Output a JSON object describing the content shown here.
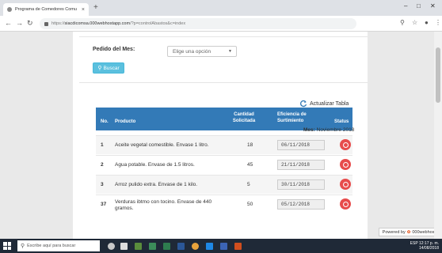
{
  "browser": {
    "tab_title": "Programa de Comedores Comu",
    "tab_close": "×",
    "new_tab": "+",
    "url_prefix": "https://",
    "url_domain": "siacdicomsa.000webhostapp.com",
    "url_path": "/?p=controlAbastos&c=index"
  },
  "form": {
    "pedido_label": "Pedido del Mes:",
    "select_value": "Elige una opción",
    "search_button": "Buscar"
  },
  "table": {
    "refresh_button": "Actualizar Tabla",
    "headers": {
      "no": "No.",
      "producto": "Producto",
      "cantidad": "Cantidad Solicitada",
      "eficiencia": "Eficiencia de Surtimiento",
      "status": "Status"
    },
    "mes_label": "Mes:",
    "mes_value": "Noviembre 2018",
    "rows": [
      {
        "no": "1",
        "producto": "Aceite vegetal comestible. Envase 1 litro.",
        "cantidad": "18",
        "fecha": "06/11/2018"
      },
      {
        "no": "2",
        "producto": "Agua potable. Envase de 1.5 litros.",
        "cantidad": "45",
        "fecha": "21/11/2018"
      },
      {
        "no": "3",
        "producto": "Arroz pulido extra. Envase de 1 kilo.",
        "cantidad": "5",
        "fecha": "30/11/2018"
      },
      {
        "no": "37",
        "producto": "Verduras ibtmo con tocino. Envase de 440 gramos.",
        "cantidad": "50",
        "fecha": "05/12/2018"
      }
    ]
  },
  "footer": {
    "powered_by": "Powered by",
    "host_name": "000webhost"
  },
  "taskbar": {
    "search_placeholder": "Escribe aquí para buscar",
    "time": "12:17 p. m.",
    "date": "14/08/2018",
    "lang": "ESP"
  },
  "colors": {
    "header_blue": "#337ab7",
    "button_info": "#5bc0de",
    "status_red": "#e74c4c"
  }
}
